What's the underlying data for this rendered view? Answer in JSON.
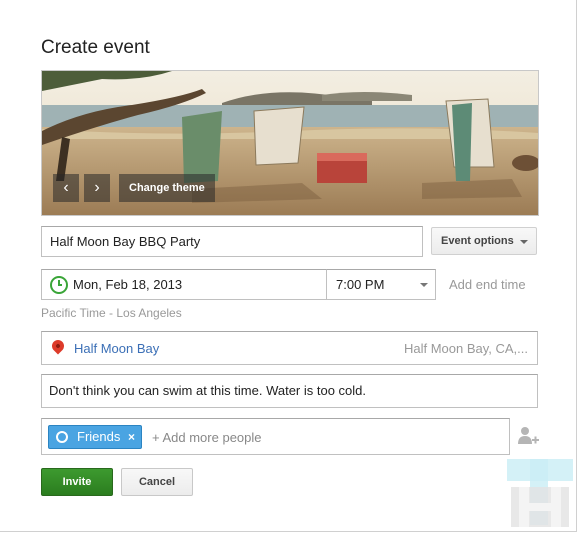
{
  "dialog": {
    "title": "Create event"
  },
  "theme": {
    "prev_icon": "chevron-left-icon",
    "next_icon": "chevron-right-icon",
    "change_label": "Change theme"
  },
  "event": {
    "title_value": "Half Moon Bay BBQ Party",
    "options_label": "Event options"
  },
  "when": {
    "icon": "clock-icon",
    "date": "Mon, Feb 18, 2013",
    "time": "7:00 PM",
    "add_end_label": "Add end time",
    "timezone": "Pacific Time - Los Angeles"
  },
  "where": {
    "icon": "map-pin-icon",
    "place": "Half Moon Bay",
    "address": "Half Moon Bay, CA,..."
  },
  "description": {
    "value": "Don't think you can swim at this time.  Water is too cold."
  },
  "guests": {
    "chip_label": "Friends",
    "chip_remove": "×",
    "add_placeholder": "+ Add more people",
    "add_icon": "person-add-icon"
  },
  "actions": {
    "invite_label": "Invite",
    "cancel_label": "Cancel"
  },
  "colors": {
    "invite_green": "#2f8a22",
    "chip_blue": "#4aa4e2",
    "clock_green": "#3aa538",
    "pin_red": "#dd3b2a",
    "link_blue": "#3b6fb6"
  }
}
